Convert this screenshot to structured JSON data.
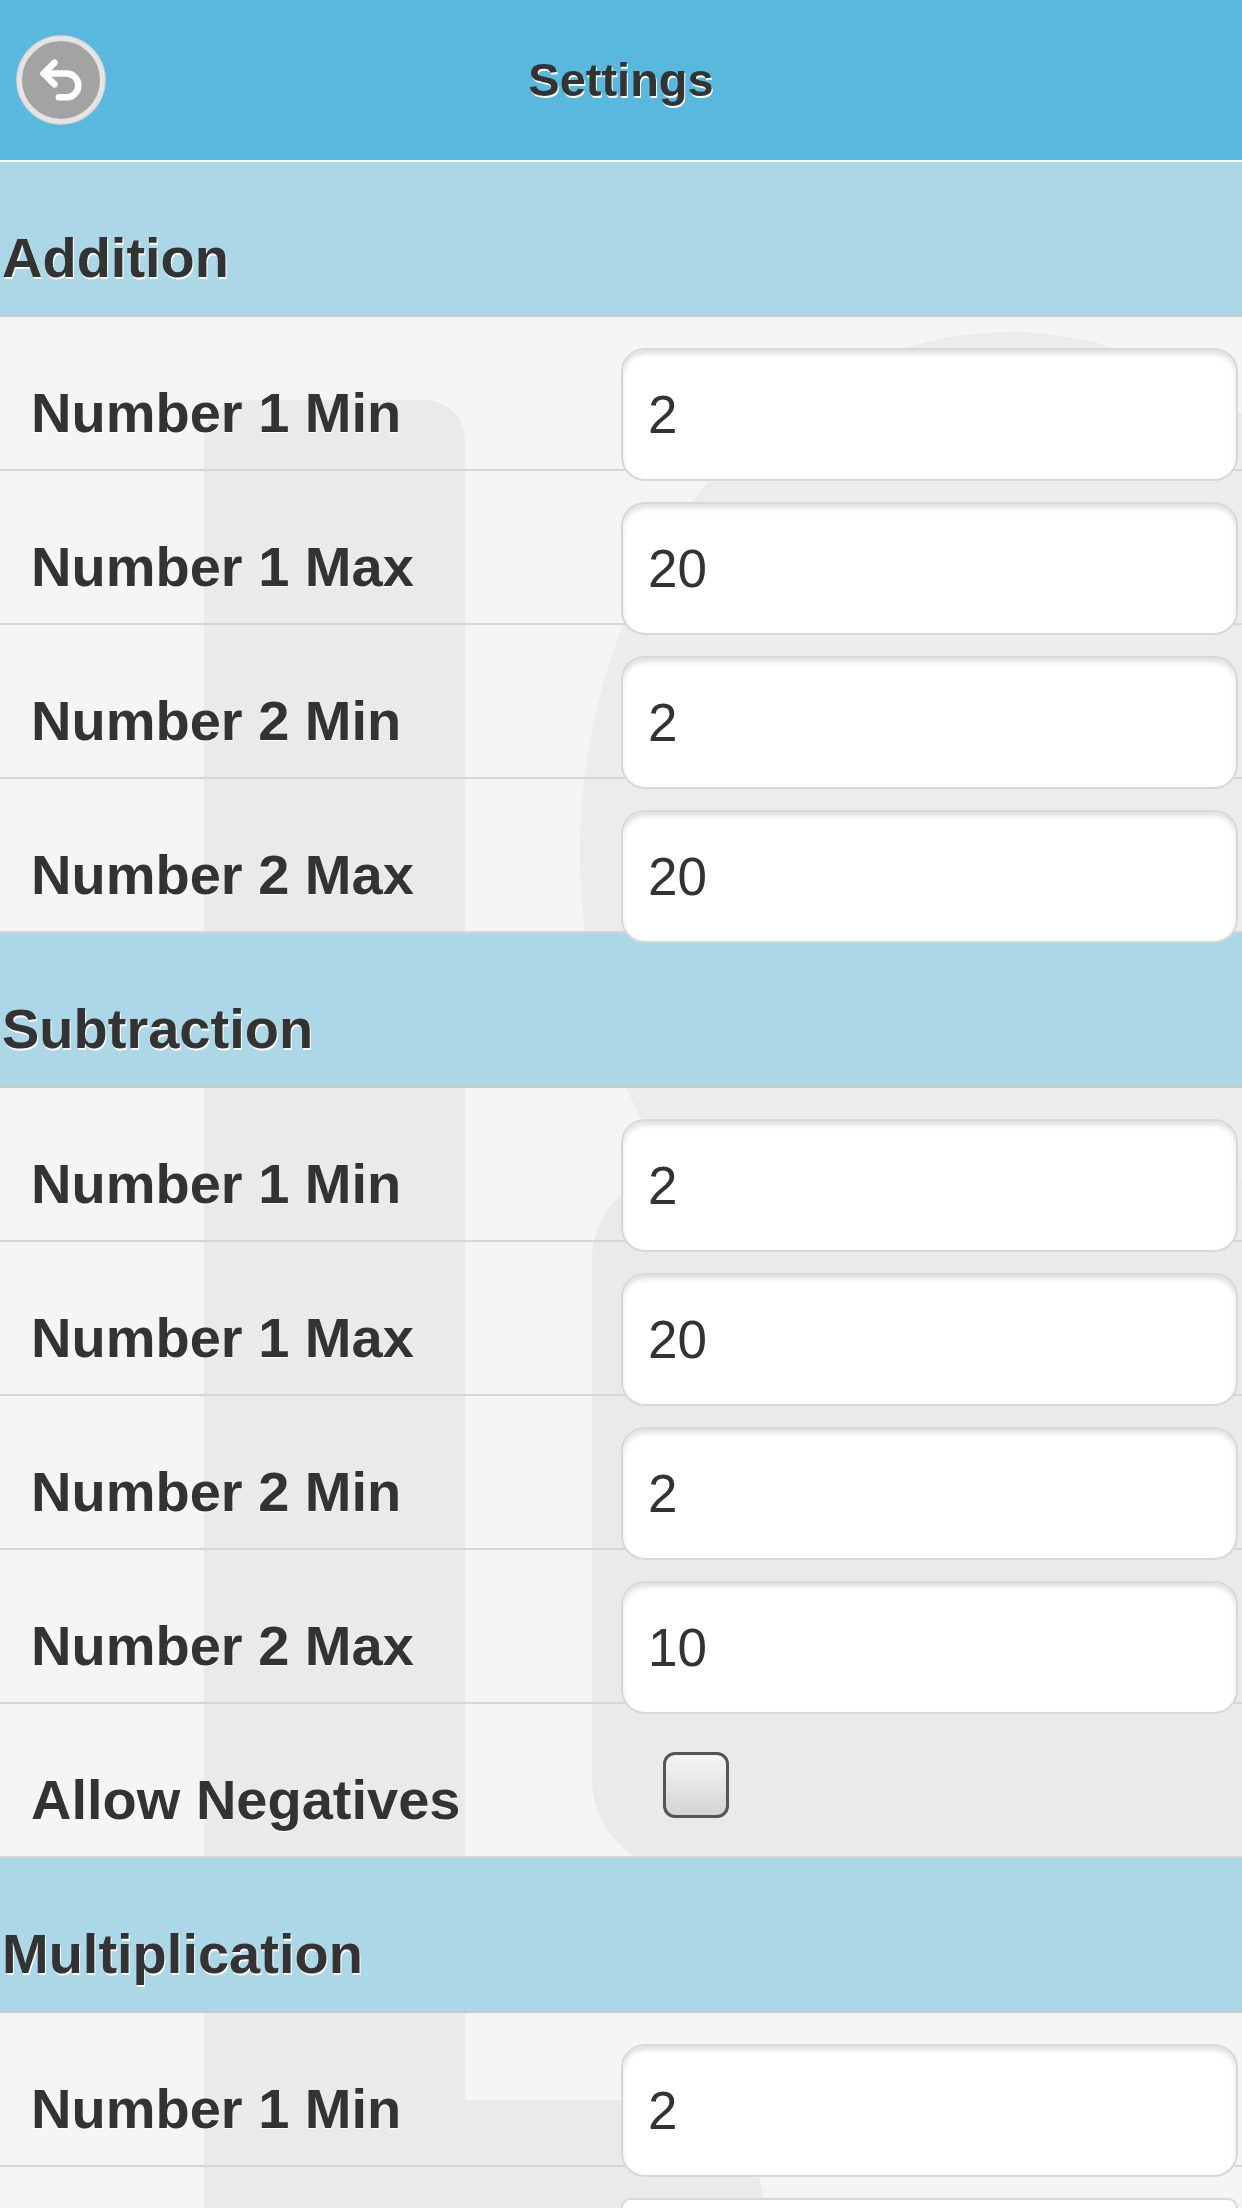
{
  "header": {
    "title": "Settings"
  },
  "sections": [
    {
      "title": "Addition",
      "rows": [
        {
          "kind": "number",
          "label": "Number 1 Min",
          "value": "2"
        },
        {
          "kind": "number",
          "label": "Number 1 Max",
          "value": "20"
        },
        {
          "kind": "number",
          "label": "Number 2 Min",
          "value": "2"
        },
        {
          "kind": "number",
          "label": "Number 2 Max",
          "value": "20"
        }
      ]
    },
    {
      "title": "Subtraction",
      "rows": [
        {
          "kind": "number",
          "label": "Number 1 Min",
          "value": "2"
        },
        {
          "kind": "number",
          "label": "Number 1 Max",
          "value": "20"
        },
        {
          "kind": "number",
          "label": "Number 2 Min",
          "value": "2"
        },
        {
          "kind": "number",
          "label": "Number 2 Max",
          "value": "10"
        },
        {
          "kind": "checkbox",
          "label": "Allow Negatives",
          "checked": false
        }
      ]
    },
    {
      "title": "Multiplication",
      "rows": [
        {
          "kind": "number",
          "label": "Number 1 Min",
          "value": "2"
        },
        {
          "kind": "partial"
        }
      ]
    }
  ]
}
